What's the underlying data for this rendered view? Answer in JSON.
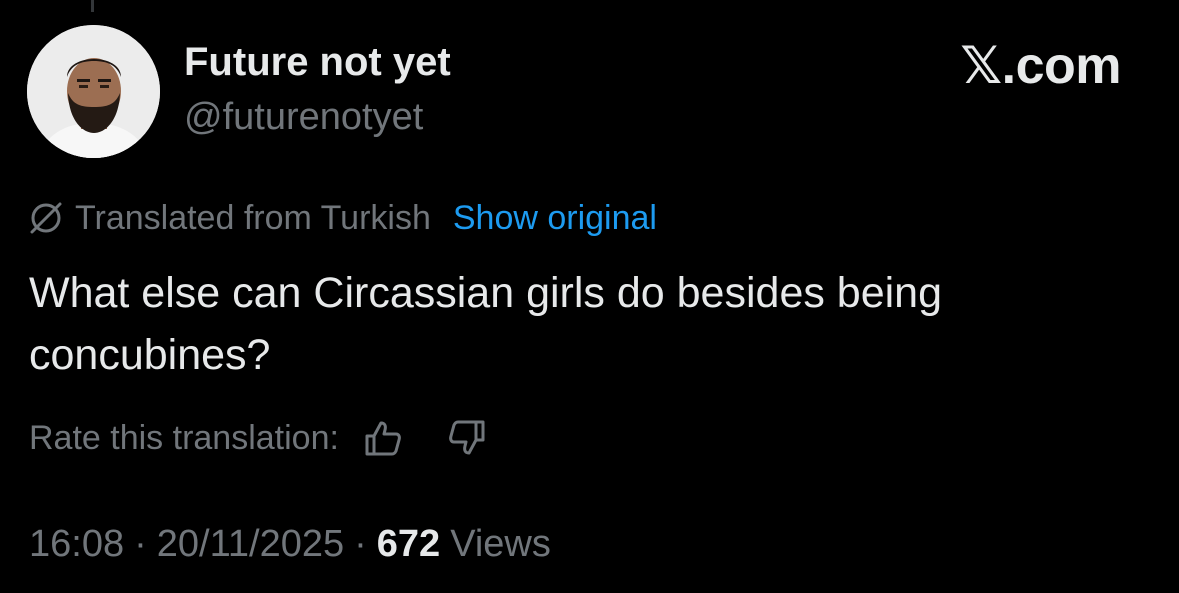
{
  "author": {
    "display_name": "Future not yet",
    "handle": "@futurenotyet"
  },
  "brand": {
    "label": "𝕏.com"
  },
  "translation": {
    "label": "Translated from Turkish",
    "show_original": "Show original",
    "icon": "globe-slash-icon",
    "link_color": "#1d9bf0"
  },
  "tweet": {
    "text": "What else can Circassian girls do besides being concubines?"
  },
  "rating": {
    "label": "Rate this translation:",
    "up_icon": "thumbs-up-icon",
    "down_icon": "thumbs-down-icon"
  },
  "meta": {
    "time": "16:08",
    "date": "20/11/2025",
    "separator": "·",
    "views_count": "672",
    "views_label": "Views"
  },
  "colors": {
    "background": "#000000",
    "primary_text": "#e7e9ea",
    "secondary_text": "#71767b"
  }
}
